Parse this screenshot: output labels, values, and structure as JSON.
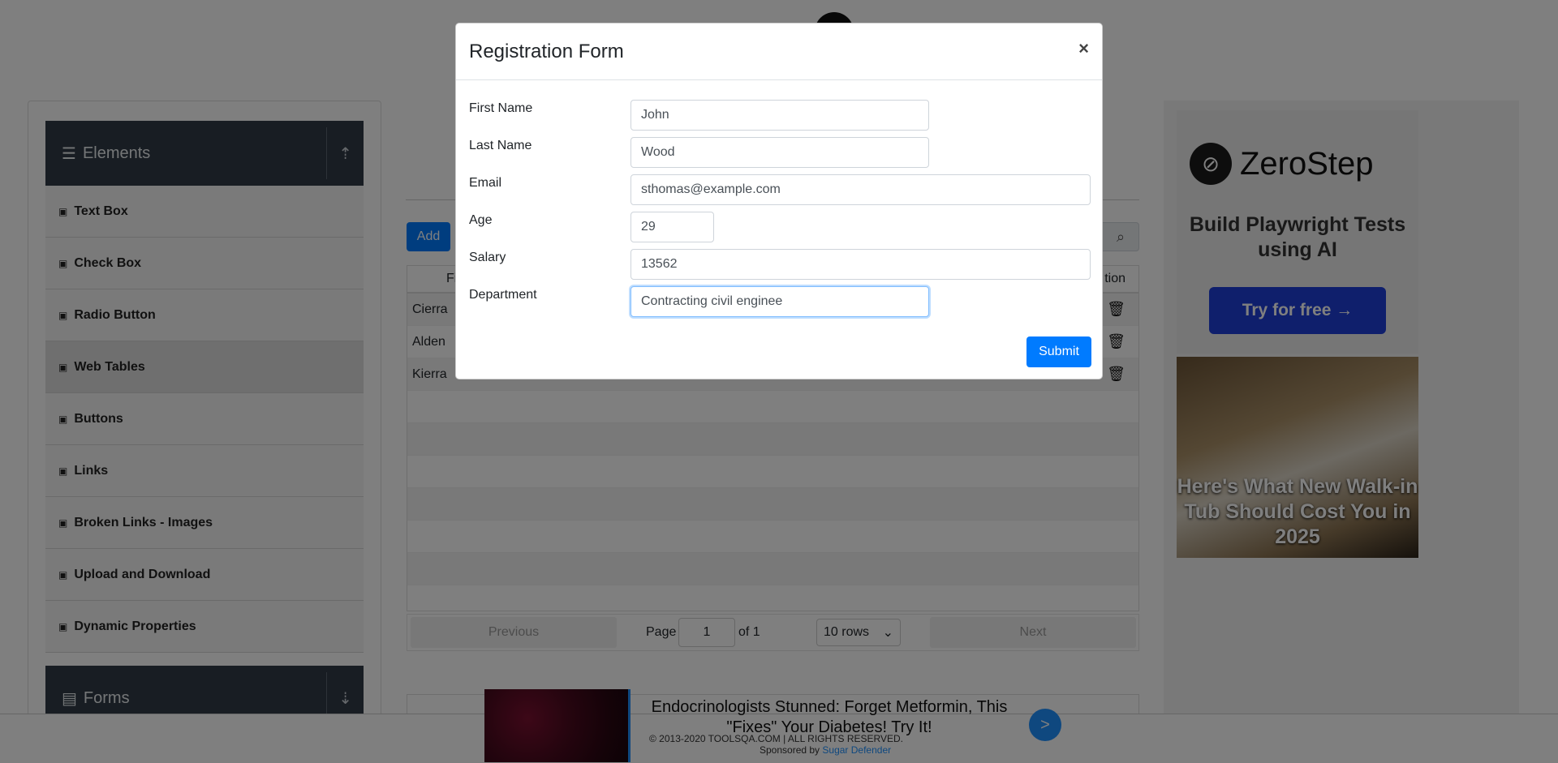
{
  "sidebar": {
    "elements_header": "Elements",
    "forms_header": "Forms",
    "items": [
      {
        "label": "Text Box"
      },
      {
        "label": "Check Box"
      },
      {
        "label": "Radio Button"
      },
      {
        "label": "Web Tables"
      },
      {
        "label": "Buttons"
      },
      {
        "label": "Links"
      },
      {
        "label": "Broken Links - Images"
      },
      {
        "label": "Upload and Download"
      },
      {
        "label": "Dynamic Properties"
      }
    ]
  },
  "table": {
    "add_label": "Add",
    "header_first": "Fi",
    "header_action": "tion",
    "rows": [
      {
        "first": "Cierra"
      },
      {
        "first": "Alden"
      },
      {
        "first": "Kierra"
      }
    ],
    "pager": {
      "previous": "Previous",
      "page_label": "Page",
      "page_value": "1",
      "of_label": "of 1",
      "rows_option": "10 rows",
      "next": "Next"
    }
  },
  "modal": {
    "title": "Registration Form",
    "close": "×",
    "fields": {
      "first_name": {
        "label": "First Name",
        "value": "John"
      },
      "last_name": {
        "label": "Last Name",
        "value": "Wood"
      },
      "email": {
        "label": "Email",
        "value": "sthomas@example.com"
      },
      "age": {
        "label": "Age",
        "value": "29"
      },
      "salary": {
        "label": "Salary",
        "value": "13562"
      },
      "department": {
        "label": "Department",
        "value": "Contracting civil enginee"
      }
    },
    "submit_label": "Submit"
  },
  "ads": {
    "zerostep": {
      "brand": "ZeroStep",
      "tagline": "Build Playwright Tests using AI",
      "cta": "Try for free →"
    },
    "tub": {
      "text": "Here's What New Walk-in Tub Should Cost You in 2025"
    },
    "bottom": {
      "text": "Endocrinologists Stunned: Forget Metformin, This \"Fixes\" Your Diabetes! Try It!",
      "go": ">"
    }
  },
  "footer": {
    "copyright": "© 2013-2020 TOOLSQA.COM | ALL RIGHTS RESERVED.",
    "sponsored_prefix": "Sponsored by",
    "sponsored_link": "Sugar Defender"
  },
  "colors": {
    "primary": "#007bff",
    "sidebar_header": "#303b47",
    "zerostep_cta": "#1f3fd8"
  }
}
